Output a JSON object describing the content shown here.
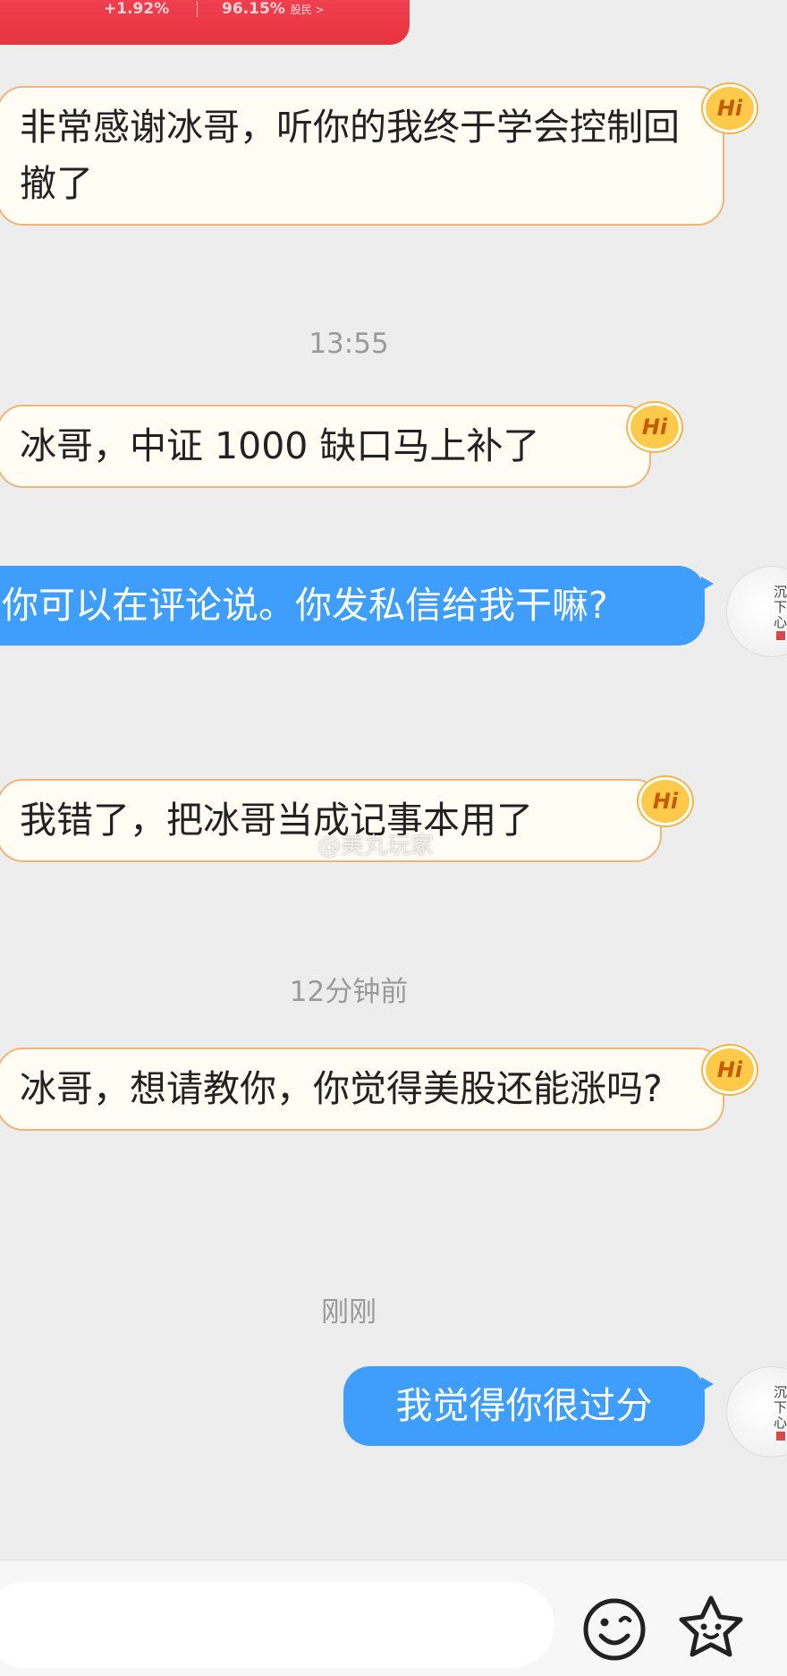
{
  "top_card": {
    "change": "+1.92%",
    "percent": "96.15%",
    "label": "股民 >"
  },
  "messages": [
    {
      "text": "非常感谢冰哥，听你的我终于学会控制回撤了",
      "badge": "Hi"
    },
    {
      "time": "13:55"
    },
    {
      "text": "冰哥，中证 1000 缺口马上补了",
      "badge": "Hi"
    },
    {
      "text": "你可以在评论说。你发私信给我干嘛?",
      "avatar_text": "沉下心"
    },
    {
      "text": "我错了，把冰哥当成记事本用了",
      "badge": "Hi"
    },
    {
      "time": "12分钟前"
    },
    {
      "text": "冰哥，想请教你，你觉得美股还能涨吗?",
      "badge": "Hi"
    },
    {
      "time": "刚刚"
    },
    {
      "text": "我觉得你很过分",
      "avatar_text": "沉下心"
    }
  ],
  "watermark": "@美丸玩家",
  "bottom_bar": {
    "input_value": "",
    "icons": [
      "emoji-icon",
      "star-face-icon"
    ]
  },
  "colors": {
    "background": "#ededed",
    "outgoing_bubble": "#3f9dfb",
    "incoming_bubble": "#fffcf4",
    "incoming_border": "#f0b47c",
    "badge": "#ffc94a",
    "card": "#e8333f"
  }
}
